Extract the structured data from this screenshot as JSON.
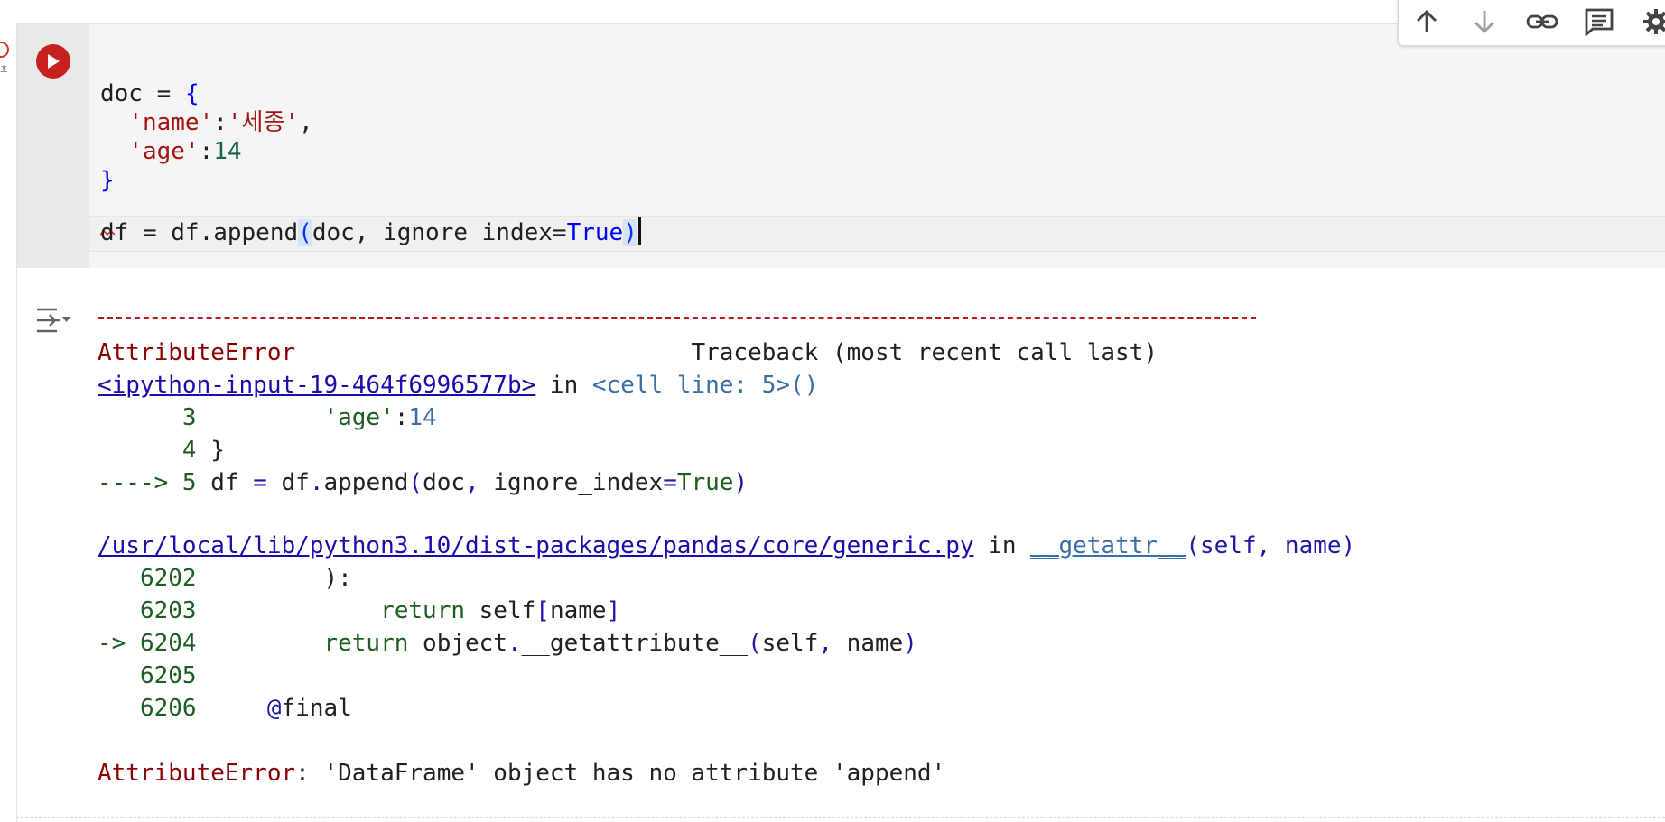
{
  "cell": {
    "code_lines": {
      "l1_var": "doc",
      "l1_op": " = ",
      "l1_brace": "{",
      "l2_key": "'name'",
      "l2_colon": ":",
      "l2_val": "'세종'",
      "l2_comma": ",",
      "l3_key": "'age'",
      "l3_colon": ":",
      "l3_val": "14",
      "l4_brace": "}",
      "l5_a": "df = df.append",
      "l5_paren_open": "(",
      "l5_b": "doc, ignore_index=",
      "l5_true": "True",
      "l5_paren_close": ")"
    },
    "run_button_icon": "play-icon"
  },
  "toolbar": {
    "icons": [
      "arrow-up-icon",
      "arrow-down-icon",
      "link-icon",
      "comment-icon",
      "gear-icon"
    ]
  },
  "output": {
    "error_name": "AttributeError",
    "traceback_header": "Traceback (most recent call last)",
    "frame1": {
      "file": "<ipython-input-19-464f6996577b>",
      "in": " in ",
      "func": "<cell line: 5>",
      "parens": "()",
      "lines": {
        "n3": "      3",
        "t3_indent": "         ",
        "t3_key": "'age'",
        "t3_colon": ":",
        "t3_val": "14",
        "n4": "      4",
        "t4": " }",
        "arrow": "----> 5",
        "t5_a": " df ",
        "t5_eq": "=",
        "t5_b": " df",
        "t5_dot": ".",
        "t5_c": "append",
        "t5_po": "(",
        "t5_d": "doc",
        "t5_comma": ",",
        "t5_e": " ignore_index",
        "t5_eq2": "=",
        "t5_true": "True",
        "t5_pc": ")"
      }
    },
    "frame2": {
      "file": "/usr/local/lib/python3.10/dist-packages/pandas/core/generic.py",
      "in": " in ",
      "func": "__getattr__",
      "args_open": "(",
      "args_self": "self",
      "args_comma": ",",
      "args_name": " name",
      "args_close": ")",
      "lines": {
        "n6202": "   6202",
        "t6202": "         ):",
        "n6203": "   6203",
        "t6203_indent": "             ",
        "t6203_kw": "return",
        "t6203_a": " self",
        "t6203_bo": "[",
        "t6203_b": "name",
        "t6203_bc": "]",
        "arrow6204": "-> 6204",
        "t6204_indent": "         ",
        "t6204_kw": "return",
        "t6204_a": " object",
        "t6204_dot": ".",
        "t6204_b": "__getattribute__",
        "t6204_po": "(",
        "t6204_c": "self",
        "t6204_comma": ",",
        "t6204_d": " name",
        "t6204_pc": ")",
        "n6205": "   6205",
        "n6206": "   6206",
        "t6206_indent": "     ",
        "t6206_at": "@",
        "t6206_word": "final"
      }
    },
    "final_error_name": "AttributeError",
    "final_error_msg": ": 'DataFrame' object has no attribute 'append'"
  },
  "sidebar_fragment": {
    "label": "초"
  }
}
